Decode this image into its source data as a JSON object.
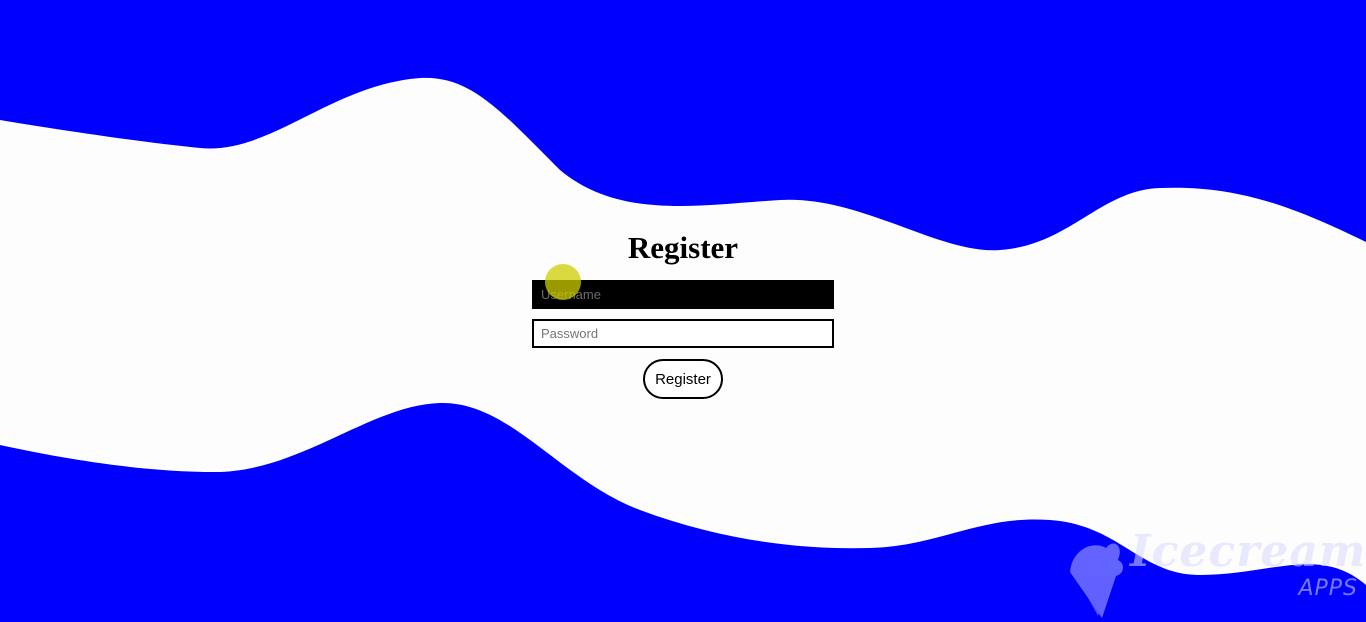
{
  "colors": {
    "wave_blue": "#0000ff",
    "background": "#fdfdfd",
    "username_fill": "#000000",
    "border": "#000000",
    "cursor_highlight": "#cdcd00"
  },
  "form": {
    "title": "Register",
    "username_placeholder": "Username",
    "password_placeholder": "Password",
    "submit_label": "Register"
  },
  "watermark": {
    "brand": "Icecream",
    "sub": "APPS",
    "icon": "ice-cream-cone-icon"
  }
}
